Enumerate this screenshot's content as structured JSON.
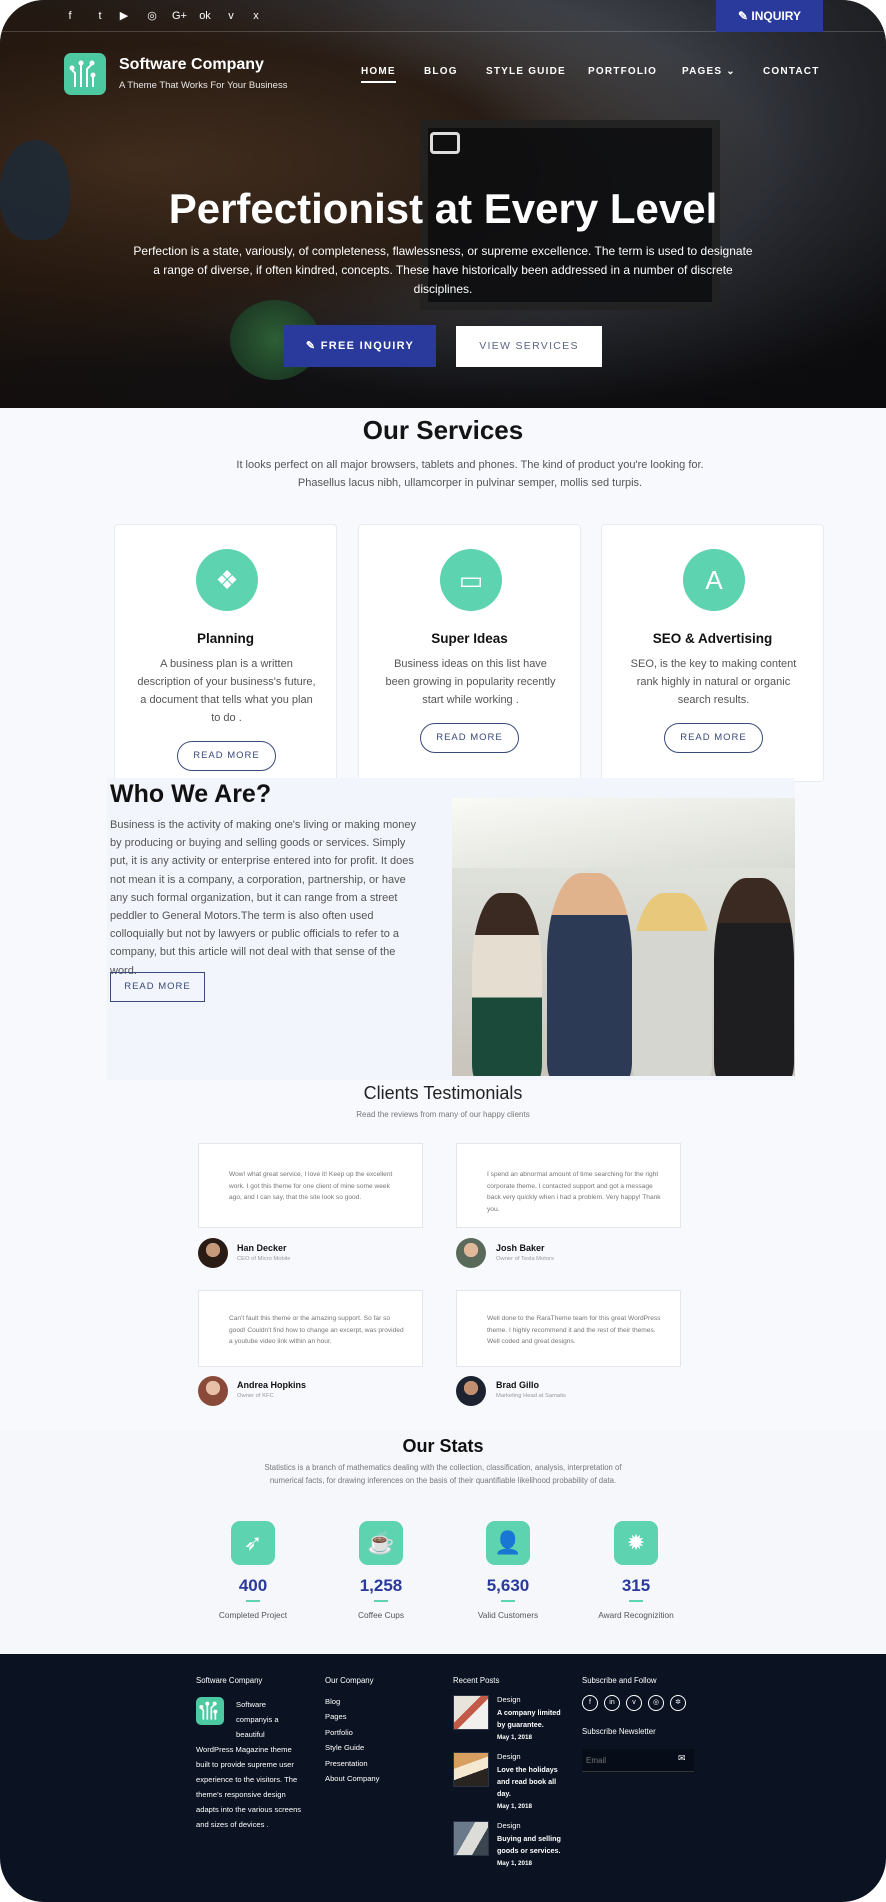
{
  "topbar": {
    "social_icons": [
      "facebook-icon",
      "twitter-icon",
      "youtube-icon",
      "instagram-icon",
      "google-plus-icon",
      "odnoklassniki-icon",
      "vimeo-icon",
      "xing-icon"
    ],
    "social_glyphs": [
      "f",
      "t",
      "▶",
      "◎",
      "G+",
      "ok",
      "v",
      "x"
    ],
    "inquiry_label": "INQUIRY",
    "inquiry_icon": "edit-icon"
  },
  "brand": {
    "title": "Software Company",
    "tagline": "A Theme That Works For Your Business"
  },
  "nav": {
    "home": "HOME",
    "blog": "BLOG",
    "style_guide": "STYLE GUIDE",
    "portfolio": "PORTFOLIO",
    "pages": "PAGES",
    "pages_caret": "⌄",
    "contact": "CONTACT"
  },
  "hero": {
    "title": "Perfectionist at Every Level",
    "text": "Perfection is a state, variously, of completeness, flawlessness, or supreme excellence. The term is used to designate a range of diverse, if often kindred, concepts. These have historically been addressed in a number of discrete disciplines.",
    "primary_label": "FREE INQUIRY",
    "secondary_label": "VIEW SERVICES"
  },
  "services": {
    "title": "Our Services",
    "text": "It looks perfect on all major browsers, tablets and phones. The kind of product you're looking for. Phasellus lacus nibh, ullamcorper in pulvinar semper, mollis sed turpis.",
    "cards": [
      {
        "icon": "shapes-icon",
        "glyph": "❖",
        "title": "Planning",
        "text": "A business plan is a written description of your business's future, a document that tells what you plan to do .",
        "button": "READ MORE"
      },
      {
        "icon": "devices-icon",
        "glyph": "▭",
        "title": "Super Ideas",
        "text": "Business ideas on this list have been growing in popularity recently start while working .",
        "button": "READ MORE"
      },
      {
        "icon": "ad-icon",
        "glyph": "A",
        "title": "SEO & Advertising",
        "text": "SEO, is the key to making content rank highly in natural or organic search results.",
        "button": "READ MORE"
      }
    ]
  },
  "who": {
    "title": "Who We Are?",
    "text": "Business is the activity of making one's living or making money by producing or buying and selling goods or services. Simply put, it is any activity or enterprise entered into for profit. It does not mean it is a company, a corporation, partnership, or have any such formal organization, but it can range from a street peddler to General Motors.The term is also often used colloquially but not by lawyers or public officials to refer to a company, but this article will not deal with that sense of the word.",
    "button": "READ MORE"
  },
  "testimonials": {
    "title": "Clients Testimonials",
    "subtitle": "Read the reviews from many of our happy clients",
    "items": [
      {
        "quote": "Wow! what great service, I love it! Keep up the excellent work. I got this theme for one client of mine some week ago, and I can say, that the site look so good.",
        "name": "Han Decker",
        "role": "CEO of Micro Mobile"
      },
      {
        "quote": "I spend an abnormal amount of time searching for the right corporate theme. I contacted support and got a message back very quickly when i had a problem. Very happy! Thank you.",
        "name": "Josh Baker",
        "role": "Owner of Tesla Motors"
      },
      {
        "quote": "Can't fault this theme or the amazing support. So far so good! Couldn't find how to change an excerpt, was provided a youtube video link within an hour.",
        "name": "Andrea Hopkins",
        "role": "Owner of KFC"
      },
      {
        "quote": "Well done to the RaraTheme team for this great WordPress theme. I highly recommend it and the rest of their themes. Well coded and great designs.",
        "name": "Brad Gillo",
        "role": "Marketing Head at Samatis"
      }
    ]
  },
  "stats": {
    "title": "Our Stats",
    "text": "Statistics is a branch of mathematics dealing with the collection, classification, analysis, interpretation of numerical facts, for drawing inferences on the basis of their quantifiable likelihood probability of data.",
    "items": [
      {
        "icon": "rocket-icon",
        "glyph": "➶",
        "value": "400",
        "label": "Completed Project"
      },
      {
        "icon": "coffee-cup-icon",
        "glyph": "☕",
        "value": "1,258",
        "label": "Coffee Cups"
      },
      {
        "icon": "user-icon",
        "glyph": "👤",
        "value": "5,630",
        "label": "Valid Customers"
      },
      {
        "icon": "award-badge-icon",
        "glyph": "✹",
        "value": "315",
        "label": "Award Recognizition"
      }
    ]
  },
  "footer": {
    "about_heading": "Software Company",
    "about_text": [
      "Software",
      "companyis a",
      "beautiful",
      "WordPress Magazine theme",
      "built to provide supreme user",
      "experience to the visitors. The",
      "theme's responsive design",
      "adapts into the various screens",
      "and sizes of devices ."
    ],
    "company_heading": "Our Company",
    "company_links": [
      "Blog",
      "Pages",
      "Portfolio",
      "Style Guide",
      "Presentation",
      "About Company"
    ],
    "posts_heading": "Recent Posts",
    "posts": [
      {
        "category": "Design",
        "title_lines": [
          "A company limited",
          "by guarantee."
        ],
        "date": "May 1, 2018"
      },
      {
        "category": "Design",
        "title_lines": [
          "Love the holidays",
          "and read book all",
          "day."
        ],
        "date": "May 1, 2018"
      },
      {
        "category": "Design",
        "title_lines": [
          "Buying and selling",
          "goods or services."
        ],
        "date": "May 1, 2018"
      }
    ],
    "follow_heading": "Subscribe and Follow",
    "follow_icons": [
      "facebook-icon",
      "linkedin-icon",
      "vimeo-icon",
      "instagram-icon",
      "dribbble-icon"
    ],
    "follow_glyphs": [
      "f",
      "in",
      "v",
      "◎",
      "✲"
    ],
    "newsletter_heading": "Subscribe Newsletter",
    "email_placeholder": "Email",
    "send_glyph": "✉"
  },
  "colors": {
    "accent": "#2a3a9c",
    "teal": "#5dd3b0",
    "footer_bg": "#0b1322"
  }
}
